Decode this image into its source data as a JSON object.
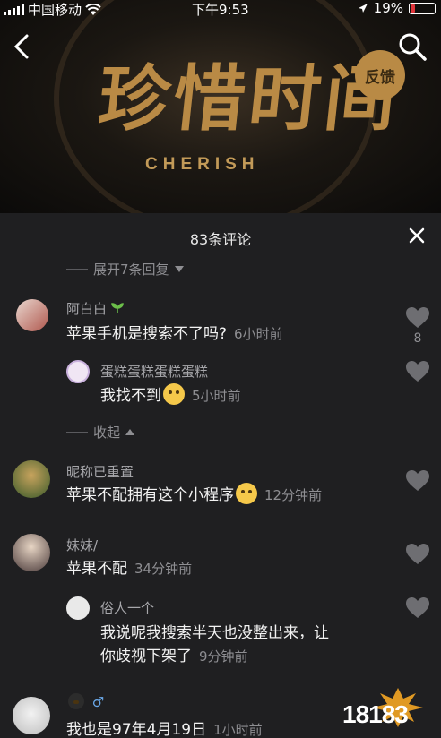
{
  "status_bar": {
    "carrier": "中国移动",
    "time": "下午9:53",
    "battery": "19%"
  },
  "hero": {
    "title": "珍惜时间",
    "subtitle": "CHERISH",
    "feedback_label": "反馈"
  },
  "sheet": {
    "title": "83条评论",
    "expand_label": "展开7条回复",
    "collapse_label": "收起"
  },
  "comments": [
    {
      "name": "阿白白",
      "text": "苹果手机是搜索不了吗?",
      "time": "6小时前",
      "likes": "8"
    },
    {
      "name": "蛋糕蛋糕蛋糕蛋糕",
      "text": "我找不到",
      "time": "5小时前"
    },
    {
      "name": "昵称已重置",
      "text": "苹果不配拥有这个小程序",
      "time": "12分钟前"
    },
    {
      "name": "妹妹/",
      "text": "苹果不配",
      "time": "34分钟前"
    },
    {
      "name": "俗人一个",
      "text_line1": "我说呢我搜索半天也没整出来，让",
      "text_line2": "你歧视下架了",
      "time": "9分钟前"
    },
    {
      "name": "♂",
      "text": "我也是97年4月19日",
      "time": "1小时前"
    }
  ],
  "watermark": {
    "text": "18183"
  },
  "colors": {
    "accent_gold": "#b98a45",
    "sheet_bg": "#1f1f21",
    "muted": "#8e8e92"
  }
}
